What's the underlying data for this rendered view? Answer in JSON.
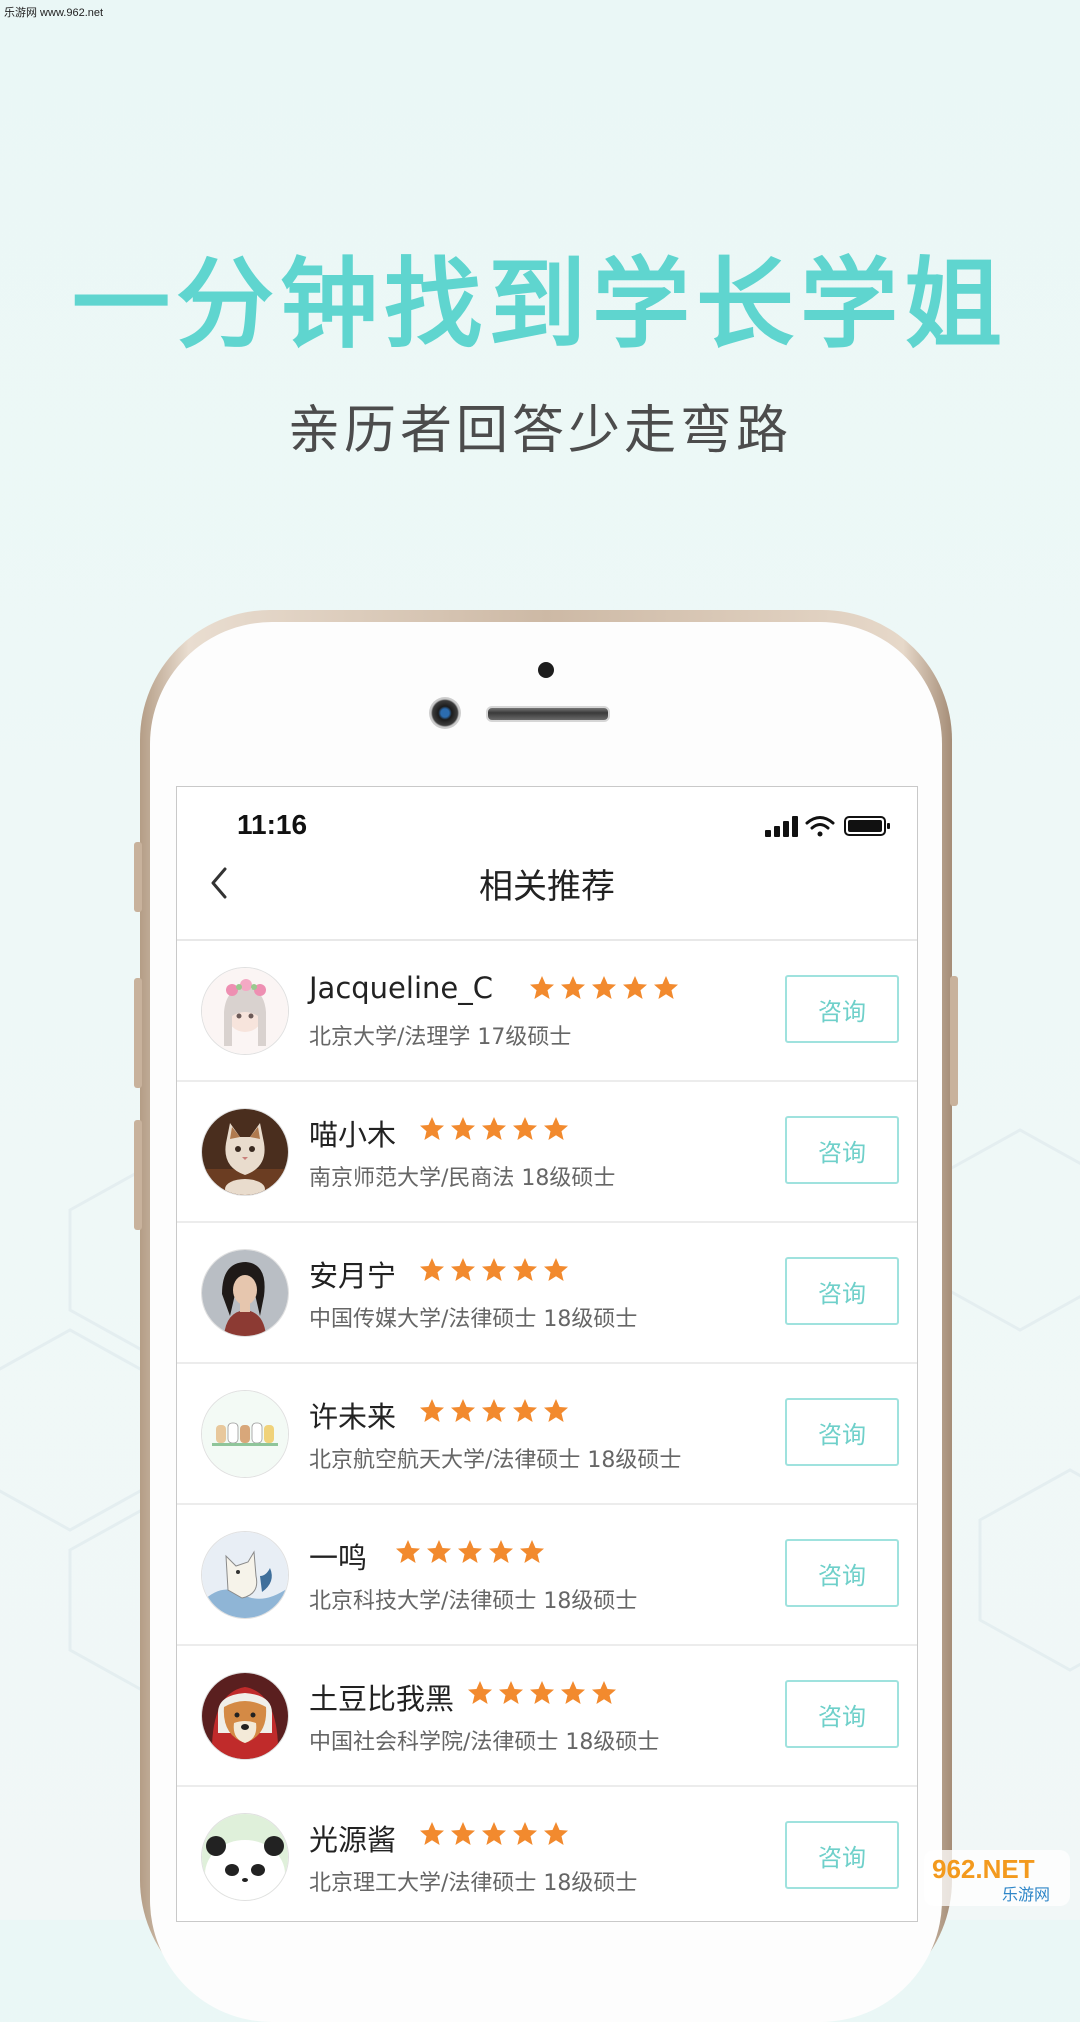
{
  "watermark": {
    "text": "乐游网 www.962.net"
  },
  "hero": {
    "headline": "一分钟找到学长学姐",
    "subline": "亲历者回答少走弯路"
  },
  "status_bar": {
    "time": "11:16"
  },
  "nav": {
    "title": "相关推荐",
    "back_icon": "chevron-left-icon"
  },
  "list": {
    "button_label": "咨询",
    "items": [
      {
        "name": "Jacqueline_C",
        "rating": 5,
        "info": "北京大学/法理学 17级硕士",
        "avatar": "girl-flower-illustration"
      },
      {
        "name": "喵小木",
        "rating": 5,
        "info": "南京师范大学/民商法 18级硕士",
        "avatar": "cat-photo"
      },
      {
        "name": "安月宁",
        "rating": 5,
        "info": "中国传媒大学/法律硕士 18级硕士",
        "avatar": "woman-portrait"
      },
      {
        "name": "许未来",
        "rating": 5,
        "info": "北京航空航天大学/法律硕士 18级硕士",
        "avatar": "cats-drawing"
      },
      {
        "name": "一鸣",
        "rating": 5,
        "info": "北京科技大学/法律硕士 18级硕士",
        "avatar": "cat-wave-illustration"
      },
      {
        "name": "土豆比我黑",
        "rating": 5,
        "info": "中国社会科学院/法律硕士 18级硕士",
        "avatar": "shiba-dog"
      },
      {
        "name": "光源酱",
        "rating": 5,
        "info": "北京理工大学/法律硕士 18级硕士",
        "avatar": "panda-cartoon"
      }
    ]
  },
  "colors": {
    "accent": "#5fd5cf",
    "star": "#f28a2e",
    "button_border": "#9fe2de",
    "button_text": "#6fd0ca"
  },
  "brand_watermark": {
    "text": "962.NET",
    "sub": "乐游网"
  }
}
